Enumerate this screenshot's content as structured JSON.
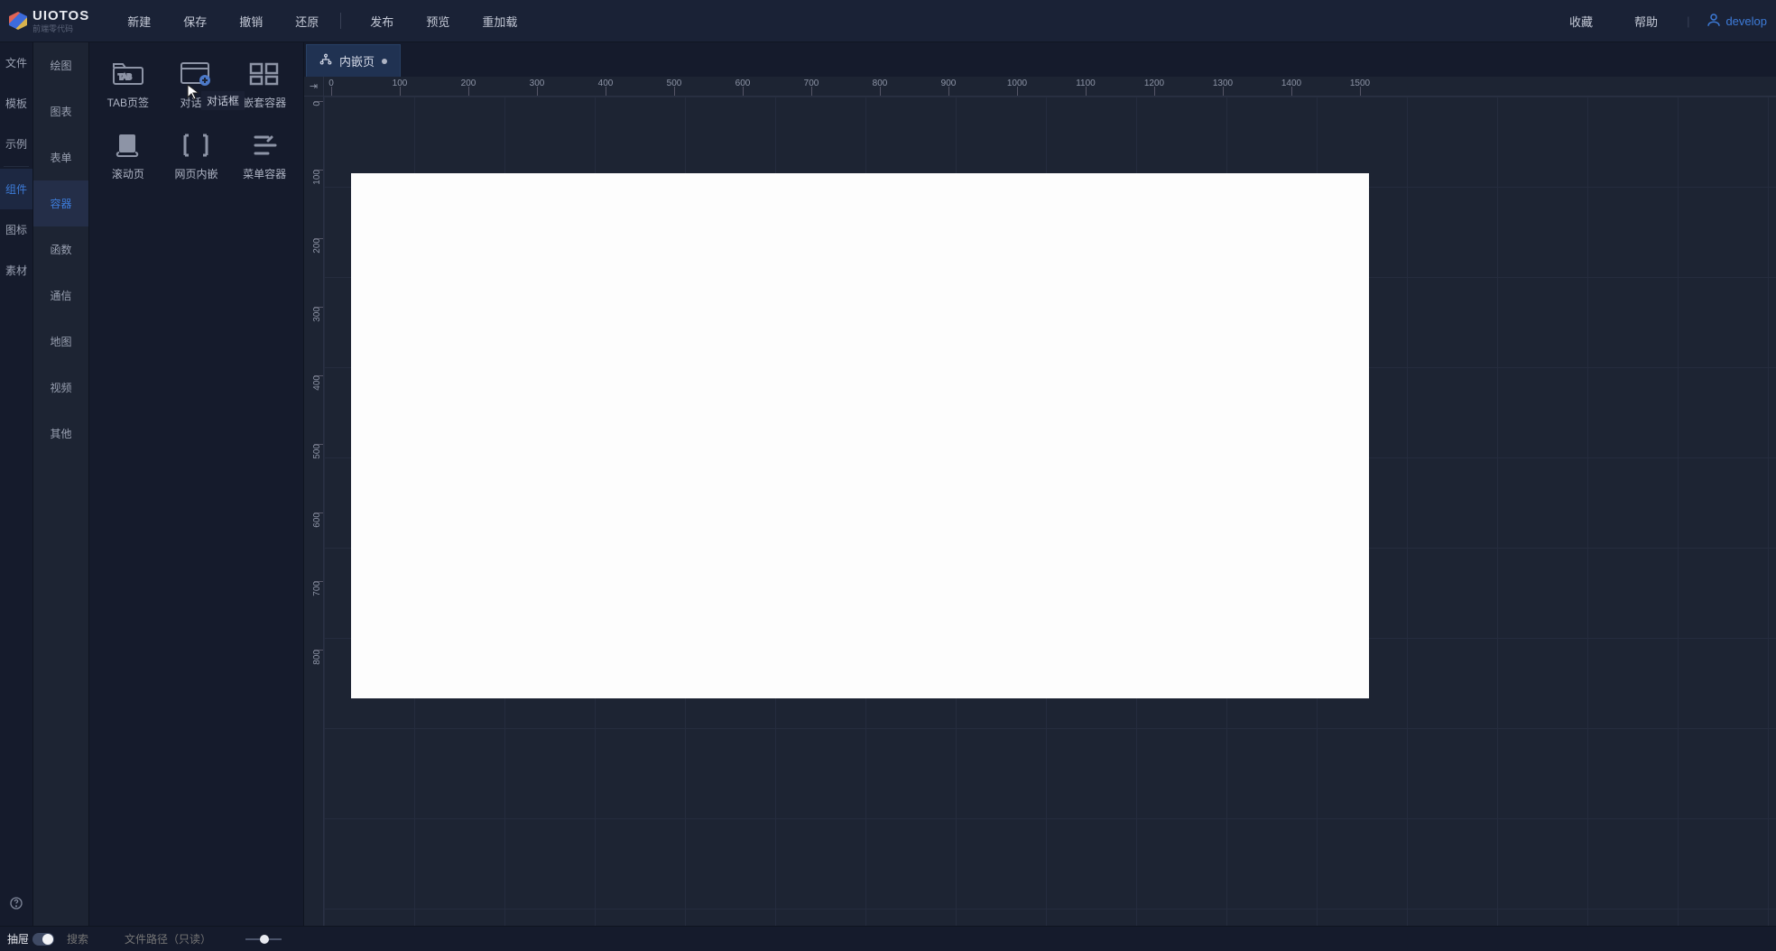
{
  "logo": {
    "name": "UIOTOS",
    "sub": "前端零代码"
  },
  "menu_left": [
    "新建",
    "保存",
    "撤销",
    "还原"
  ],
  "menu_right": [
    "发布",
    "预览",
    "重加载"
  ],
  "topbar_right": {
    "fav": "收藏",
    "help": "帮助",
    "user": "develop"
  },
  "rail1": [
    {
      "label": "文件",
      "active": false
    },
    {
      "label": "模板",
      "active": false
    },
    {
      "label": "示例",
      "active": false
    }
  ],
  "rail1b": [
    {
      "label": "组件",
      "active": true
    },
    {
      "label": "图标",
      "active": false
    },
    {
      "label": "素材",
      "active": false
    }
  ],
  "rail2": [
    {
      "label": "绘图",
      "active": false
    },
    {
      "label": "图表",
      "active": false
    },
    {
      "label": "表单",
      "active": false
    },
    {
      "label": "容器",
      "active": true
    },
    {
      "label": "函数",
      "active": false
    },
    {
      "label": "通信",
      "active": false
    },
    {
      "label": "地图",
      "active": false
    },
    {
      "label": "视频",
      "active": false
    },
    {
      "label": "其他",
      "active": false
    }
  ],
  "palette": [
    {
      "id": "tab",
      "label": "TAB页签"
    },
    {
      "id": "dialog",
      "label": "对话框"
    },
    {
      "id": "nest",
      "label": "嵌套容器"
    },
    {
      "id": "scroll",
      "label": "滚动页"
    },
    {
      "id": "iframe",
      "label": "网页内嵌"
    },
    {
      "id": "menu",
      "label": "菜单容器"
    }
  ],
  "tooltip": "对话框",
  "tab": {
    "label": "内嵌页"
  },
  "ruler": {
    "corner": "⇥",
    "h": [
      "0",
      "100",
      "200",
      "300",
      "400",
      "500",
      "600",
      "700",
      "800",
      "900",
      "1000",
      "1100",
      "1200",
      "1300",
      "1400",
      "1500"
    ],
    "v": [
      "0",
      "100",
      "200",
      "300",
      "400",
      "500",
      "600",
      "700",
      "800"
    ]
  },
  "footer": {
    "drawer": "抽屉",
    "search_placeholder": "搜索",
    "path_placeholder": "文件路径（只读）"
  }
}
